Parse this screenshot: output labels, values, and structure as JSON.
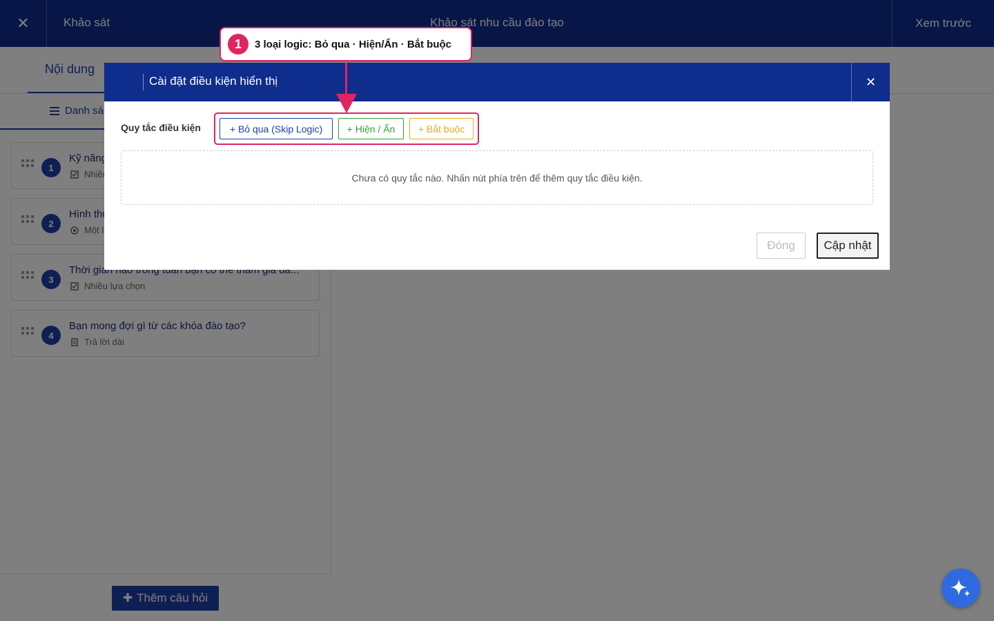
{
  "topbar": {
    "close_icon": "close-icon",
    "section_label": "Khảo sát",
    "title": "Khảo sát nhu cầu đào tạo",
    "preview_label": "Xem trước"
  },
  "tabs": {
    "content_label": "Nội dung"
  },
  "left_panel": {
    "list_tab_label": "Danh sách",
    "questions": [
      {
        "number": "1",
        "title": "Kỹ năng",
        "type": "Nhiều lựa chọn",
        "type_icon": "checkbox-icon"
      },
      {
        "number": "2",
        "title": "Hình thức",
        "type": "Một lựa chọn",
        "type_icon": "radio-icon"
      },
      {
        "number": "3",
        "title": "Thời gian nào trong tuần bạn có thể tham gia đà...",
        "type": "Nhiều lựa chọn",
        "type_icon": "checkbox-icon"
      },
      {
        "number": "4",
        "title": "Bạn mong đợi gì từ các khóa đào tạo?",
        "type": "Trả lời dài",
        "type_icon": "document-icon"
      }
    ],
    "add_button_label": "Thêm câu hỏi"
  },
  "modal": {
    "title": "Cài đặt điều kiện hiển thị",
    "rules_label": "Quy tắc điều kiện",
    "skip_button": "+ Bỏ qua (Skip Logic)",
    "show_hide_button": "+ Hiện / Ẩn",
    "required_button": "+ Bắt buộc",
    "empty_message": "Chưa có quy tắc nào. Nhấn nút phía trên để thêm quy tắc điều kiện.",
    "close_button": "Đóng",
    "update_button": "Cập nhật"
  },
  "callout": {
    "badge": "1",
    "text": "3 loại logic: Bỏ qua · Hiện/Ẩn · Bắt buộc"
  },
  "colors": {
    "primary": "#0f2d8c",
    "accent_blue": "#1d3ea8",
    "green": "#2ea52e",
    "orange": "#f0a81c",
    "highlight": "#e0245e",
    "ai_button": "#2f6ae0"
  }
}
